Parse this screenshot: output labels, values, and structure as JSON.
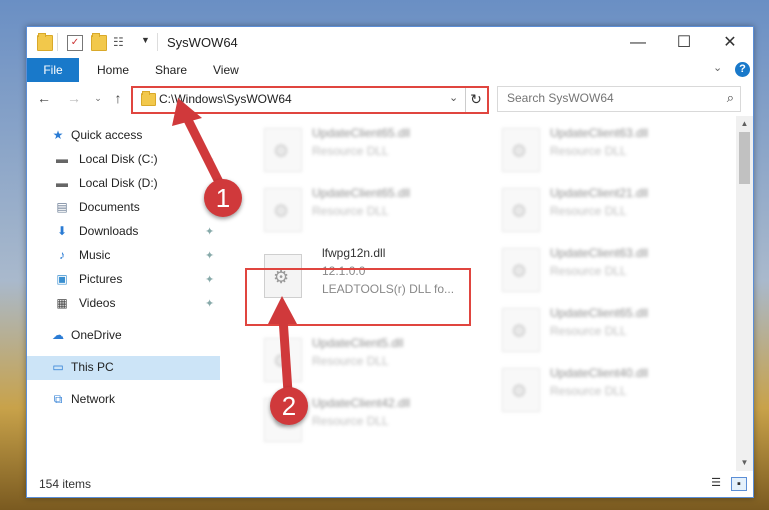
{
  "window": {
    "title": "SysWOW64",
    "controls": {
      "minimize": "—",
      "maximize": "☐",
      "close": "✕"
    }
  },
  "ribbon": {
    "file": "File",
    "tabs": [
      "Home",
      "Share",
      "View"
    ],
    "help": "?"
  },
  "address": {
    "path": "C:\\Windows\\SysWOW64",
    "search_placeholder": "Search SysWOW64"
  },
  "sidebar": {
    "items": [
      {
        "label": "Quick access",
        "icon": "star-icon",
        "pinned": false
      },
      {
        "label": "Local Disk (C:)",
        "icon": "drive-icon",
        "pinned": true
      },
      {
        "label": "Local Disk (D:)",
        "icon": "drive-icon",
        "pinned": false
      },
      {
        "label": "Documents",
        "icon": "documents-icon",
        "pinned": true
      },
      {
        "label": "Downloads",
        "icon": "download-icon",
        "pinned": true
      },
      {
        "label": "Music",
        "icon": "music-icon",
        "pinned": true
      },
      {
        "label": "Pictures",
        "icon": "pictures-icon",
        "pinned": true
      },
      {
        "label": "Videos",
        "icon": "videos-icon",
        "pinned": true
      },
      {
        "label": "OneDrive",
        "icon": "cloud-icon",
        "pinned": false
      },
      {
        "label": "This PC",
        "icon": "computer-icon",
        "pinned": false
      },
      {
        "label": "Network",
        "icon": "network-icon",
        "pinned": false
      }
    ],
    "selected": "This PC"
  },
  "files": {
    "left": [
      {
        "name": "UpdateClient65.dll",
        "desc": "Resource DLL"
      },
      {
        "name": "UpdateClient65.dll",
        "desc": "Resource DLL"
      },
      {
        "name": "lfwpg12n.dll",
        "desc": "12.1.0.0",
        "extra": "LEADTOOLS(r) DLL fo..."
      },
      {
        "name": "UpdateClient5.dll",
        "desc": "Resource DLL"
      },
      {
        "name": "UpdateClient42.dll",
        "desc": "Resource DLL"
      }
    ],
    "right": [
      {
        "name": "UpdateClient63.dll",
        "desc": "Resource DLL"
      },
      {
        "name": "UpdateClient21.dll",
        "desc": "Resource DLL"
      },
      {
        "name": "UpdateClient63.dll",
        "desc": "Resource DLL"
      },
      {
        "name": "UpdateClient65.dll",
        "desc": "Resource DLL"
      },
      {
        "name": "UpdateClient40.dll",
        "desc": "Resource DLL"
      }
    ]
  },
  "status": {
    "count": "154 items"
  },
  "callouts": {
    "one": "1",
    "two": "2"
  },
  "colors": {
    "accent": "#1979ca",
    "highlight": "#e0453f",
    "callout": "#d0393b"
  }
}
